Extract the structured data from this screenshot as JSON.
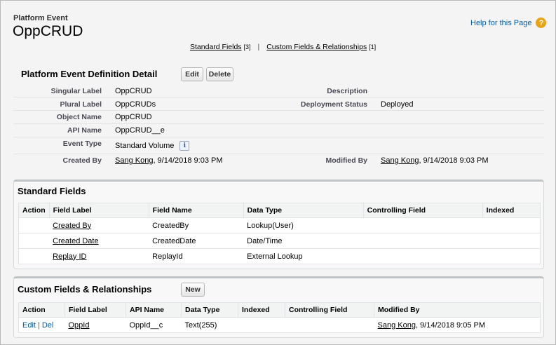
{
  "header": {
    "subtitle": "Platform Event",
    "title": "OppCRUD",
    "help_label": "Help for this Page",
    "help_icon": "help-icon"
  },
  "links": {
    "standard": "Standard Fields",
    "standard_count": "[3]",
    "separator": "|",
    "custom": "Custom Fields & Relationships",
    "custom_count": "[1]"
  },
  "detail": {
    "title": "Platform Event Definition Detail",
    "edit_label": "Edit",
    "delete_label": "Delete",
    "singular_label": "Singular Label",
    "singular_value": "OppCRUD",
    "plural_label": "Plural Label",
    "plural_value": "OppCRUDs",
    "object_name_label": "Object Name",
    "object_name_value": "OppCRUD",
    "api_name_label": "API Name",
    "api_name_value": "OppCRUD__e",
    "event_type_label": "Event Type",
    "event_type_value": "Standard Volume",
    "created_by_label": "Created By",
    "created_by_user": "Sang Kong",
    "created_by_date": ", 9/14/2018 9:03 PM",
    "description_label": "Description",
    "description_value": "",
    "deployment_label": "Deployment Status",
    "deployment_value": "Deployed",
    "modified_by_label": "Modified By",
    "modified_by_user": "Sang Kong",
    "modified_by_date": ", 9/14/2018 9:03 PM"
  },
  "standard_fields": {
    "title": "Standard Fields",
    "headers": [
      "Action",
      "Field Label",
      "Field Name",
      "Data Type",
      "Controlling Field",
      "Indexed"
    ],
    "rows": [
      {
        "label": "Created By",
        "name": "CreatedBy",
        "type": "Lookup(User)"
      },
      {
        "label": "Created Date",
        "name": "CreatedDate",
        "type": "Date/Time"
      },
      {
        "label": "Replay ID",
        "name": "ReplayId",
        "type": "External Lookup"
      }
    ]
  },
  "custom_fields": {
    "title": "Custom Fields & Relationships",
    "new_label": "New",
    "headers": [
      "Action",
      "Field Label",
      "API Name",
      "Data Type",
      "Indexed",
      "Controlling Field",
      "Modified By"
    ],
    "rows": [
      {
        "edit": "Edit",
        "sep": "|",
        "del": "Del",
        "label": "OppId",
        "api": "OppId__c",
        "type": "Text(255)",
        "indexed": "",
        "controlling": "",
        "mod_user": "Sang Kong",
        "mod_date": ", 9/14/2018 9:05 PM"
      }
    ]
  }
}
